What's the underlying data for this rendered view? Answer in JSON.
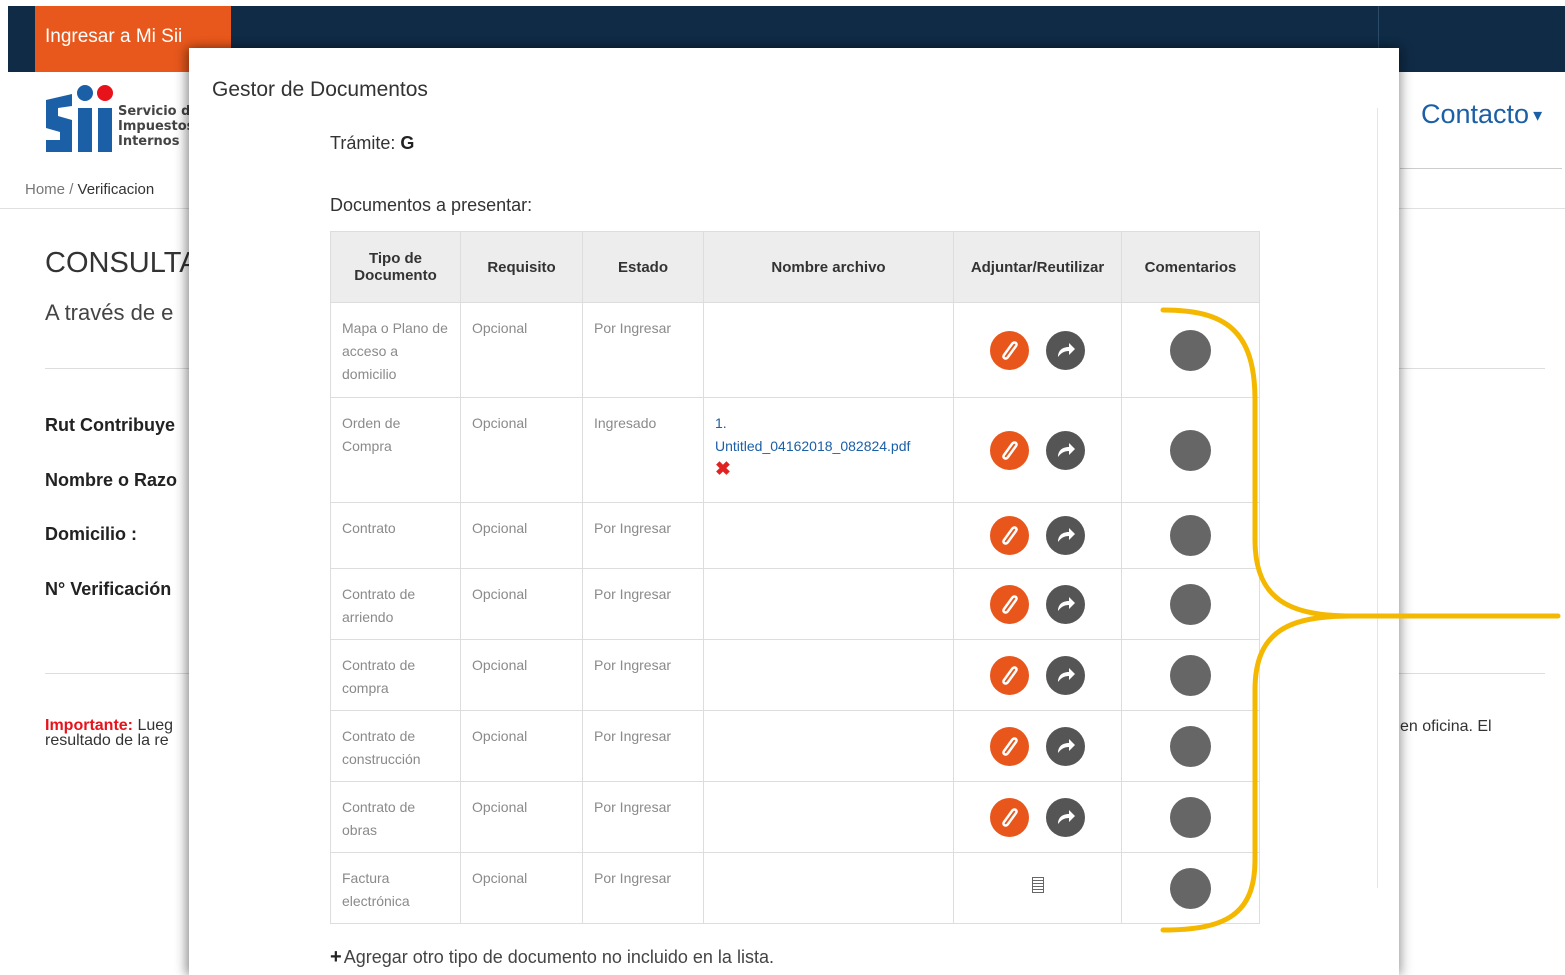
{
  "header": {
    "login_label": "Ingresar a Mi Sii",
    "contact_label": "Contacto",
    "contact_caret": "▾"
  },
  "logo": {
    "mark": "Sii",
    "line1": "Servicio de",
    "line2": "Impuestos",
    "line3": "Internos"
  },
  "breadcrumb": {
    "home": "Home",
    "sep": "/",
    "current": "Verificacion"
  },
  "page": {
    "title": "CONSULTA",
    "intro": "A través de e",
    "fields": {
      "rut": "Rut Contribuye",
      "nombre": "Nombre o Razo",
      "domicilio": "Domicilio :",
      "verificacion": "N° Verificación"
    },
    "important_label": "Importante:",
    "important_text": "Lueg",
    "important_text2": "resultado de la re",
    "office_text": "en oficina. El"
  },
  "modal": {
    "title": "Gestor de Documentos",
    "tramite_label": "Trámite:",
    "tramite_value": "G",
    "docs_label": "Documentos a presentar:",
    "columns": [
      "Tipo de Documento",
      "Requisito",
      "Estado",
      "Nombre archivo",
      "Adjuntar/Reutilizar",
      "Comentarios"
    ],
    "rows": [
      {
        "tipo": "Mapa o Plano de acceso a domicilio",
        "requisito": "Opcional",
        "estado": "Por Ingresar",
        "archivo": "",
        "archivo_num": "",
        "actions": "attach-reuse"
      },
      {
        "tipo": "Orden de Compra",
        "requisito": "Opcional",
        "estado": "Ingresado",
        "archivo": "Untitled_04162018_082824.pdf",
        "archivo_num": "1.",
        "delete": "✖",
        "actions": "attach-reuse"
      },
      {
        "tipo": "Contrato",
        "requisito": "Opcional",
        "estado": "Por Ingresar",
        "archivo": "",
        "archivo_num": "",
        "actions": "attach-reuse"
      },
      {
        "tipo": "Contrato de arriendo",
        "requisito": "Opcional",
        "estado": "Por Ingresar",
        "archivo": "",
        "archivo_num": "",
        "actions": "attach-reuse"
      },
      {
        "tipo": "Contrato de compra",
        "requisito": "Opcional",
        "estado": "Por Ingresar",
        "archivo": "",
        "archivo_num": "",
        "actions": "attach-reuse"
      },
      {
        "tipo": "Contrato de construcción",
        "requisito": "Opcional",
        "estado": "Por Ingresar",
        "archivo": "",
        "archivo_num": "",
        "actions": "attach-reuse"
      },
      {
        "tipo": "Contrato de obras",
        "requisito": "Opcional",
        "estado": "Por Ingresar",
        "archivo": "",
        "archivo_num": "",
        "actions": "attach-reuse"
      },
      {
        "tipo": "Factura electrónica",
        "requisito": "Opcional",
        "estado": "Por Ingresar",
        "archivo": "",
        "archivo_num": "",
        "actions": "form"
      }
    ],
    "add_other_label": "Agregar otro tipo de documento no incluido en la lista."
  },
  "colors": {
    "topbar": "#102b46",
    "login": "#e8581c",
    "link": "#1b5fa7",
    "attach": "#e9561c",
    "annotation": "#f5b800"
  }
}
